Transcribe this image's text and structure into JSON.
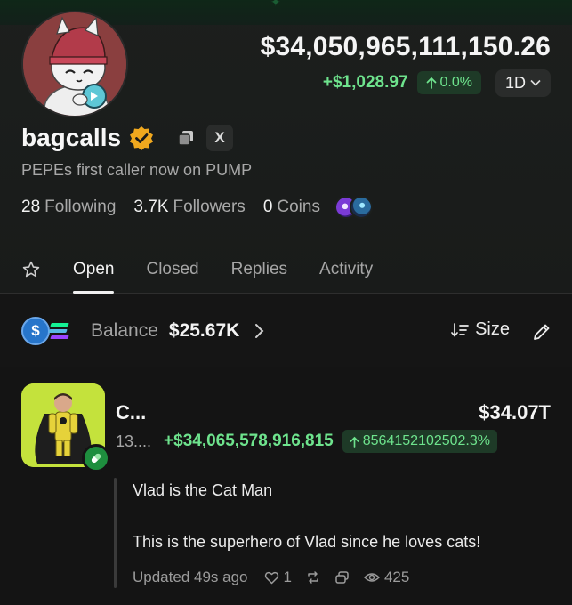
{
  "profile": {
    "portfolio_value": "$34,050,965,111,150.26",
    "pnl_amount": "+$1,028.97",
    "pnl_percent": "0.0%",
    "period": "1D",
    "username": "bagcalls",
    "x_icon_label": "X",
    "bio": "PEPEs first caller now on PUMP",
    "following_count": "28",
    "following_label": "Following",
    "followers_count": "3.7K",
    "followers_label": "Followers",
    "coins_count": "0",
    "coins_label": "Coins"
  },
  "tabs": [
    "Open",
    "Closed",
    "Replies",
    "Activity"
  ],
  "balance": {
    "usdc_symbol": "$",
    "label": "Balance",
    "value": "$25.67K",
    "sort_label": "Size"
  },
  "position": {
    "name": "C...",
    "ticker": "13....",
    "value": "$34.07T",
    "pnl": "+$34,065,578,916,815",
    "pnl_percent": "8564152102502.3%",
    "reply_line1": "Vlad is the Cat Man",
    "reply_line2": "This is the superhero of Vlad since he loves cats!",
    "updated": "Updated 49s ago",
    "likes": "1",
    "views": "425"
  },
  "colors": {
    "positive": "#6ee38d",
    "positive_bg": "#1e3a27",
    "verified": "#f0a81e",
    "usdc": "#2775ca",
    "background": "#141414"
  },
  "icons": [
    "verified-badge-icon",
    "copy-icon",
    "x-logo-icon",
    "chevron-down-icon",
    "star-icon",
    "chevron-right-icon",
    "sort-icon",
    "pencil-icon",
    "pump-pill-icon",
    "heart-icon",
    "repost-icon",
    "quote-icon",
    "eye-icon",
    "arrow-up-icon"
  ]
}
